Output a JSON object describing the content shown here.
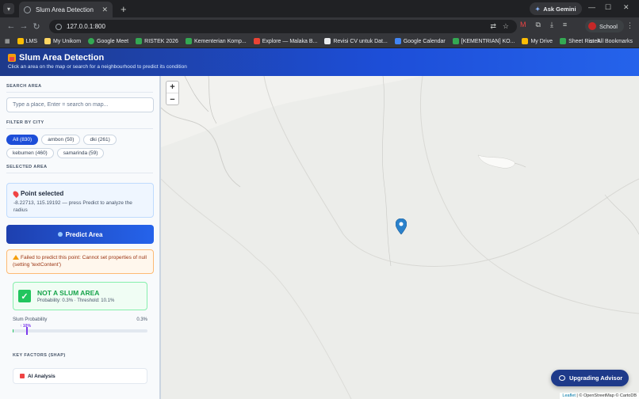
{
  "browser": {
    "tab_title": "Slum Area Detection",
    "url": "127.0.0.1:800",
    "ask_gemini": "Ask Gemini",
    "profile": "School",
    "bookmarks": [
      "LMS",
      "My Unikom",
      "Google Meet",
      "RISTEK 2026",
      "Kementerian Komp...",
      "Explore — Malaka B...",
      "Revisi CV untuk Dat...",
      "Google Calendar",
      "[KEMENTRIAN] KO...",
      "My Drive",
      "Sheet Ristek"
    ],
    "all_bookmarks": "All Bookmarks"
  },
  "header": {
    "title": "Slum Area Detection",
    "subtitle": "Click an area on the map or search for a neighbourhood to predict its condition"
  },
  "sidebar": {
    "search_label": "SEARCH AREA",
    "search_placeholder": "Type a place, Enter = search on map...",
    "filter_label": "FILTER BY CITY",
    "cities": [
      {
        "label": "All (830)",
        "active": true
      },
      {
        "label": "ambon (50)",
        "active": false
      },
      {
        "label": "dki (261)",
        "active": false
      },
      {
        "label": "kebumen (460)",
        "active": false
      },
      {
        "label": "samarinda (59)",
        "active": false
      }
    ],
    "selected_label": "SELECTED AREA",
    "point_title": "Point selected",
    "point_text": "-8.22713, 115.19192 — press Predict to analyze the radius",
    "predict_button": "Predict Area",
    "error_text": "Failed to predict this point: Cannot set properties of null (setting 'textContent')",
    "result_title": "NOT A SLUM AREA",
    "result_sub": "Probability: 0.3% · Threshold: 10.1%",
    "prob_label": "Slum Probability",
    "prob_value": "0.3%",
    "prob_fraction": 0.003,
    "threshold_label": "↑ 10%",
    "threshold_fraction": 0.101,
    "key_factors_label": "KEY FACTORS (SHAP)",
    "ai_analysis": "AI Analysis"
  },
  "map": {
    "zoom_in": "+",
    "zoom_out": "−",
    "advisor_button": "Upgrading Advisor",
    "attribution_leaflet": "Leaflet",
    "attribution_rest": " | © OpenStreetMap © CartoDB"
  },
  "colors": {
    "header_start": "#1e3a8a",
    "accent": "#1d4ed8",
    "success": "#16a34a",
    "warning_bg": "#fff7ed",
    "marker": "#2a81cb"
  }
}
